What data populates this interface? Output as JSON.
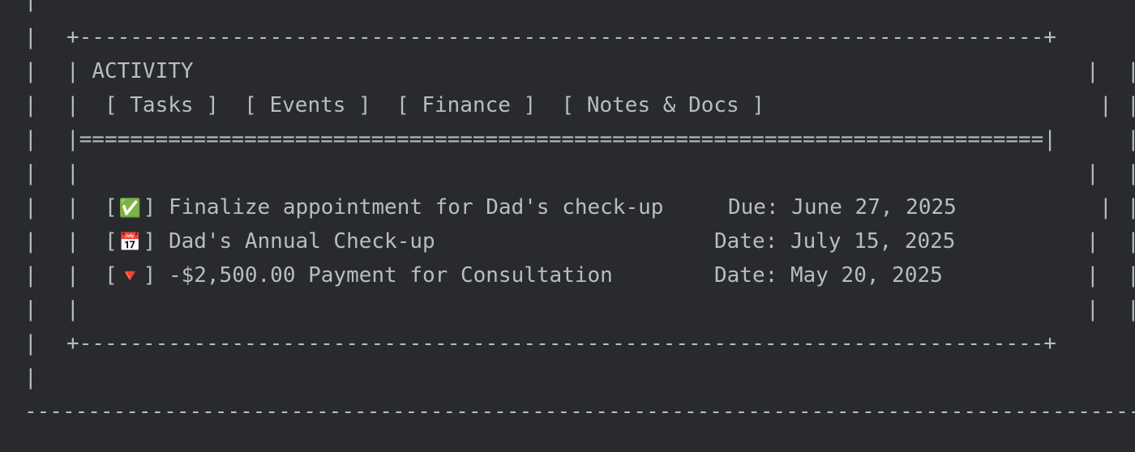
{
  "panel": {
    "title": "ACTIVITY",
    "tabs": [
      {
        "label": "[ Tasks ]"
      },
      {
        "label": "[ Events ]"
      },
      {
        "label": "[ Finance ]"
      },
      {
        "label": "[ Notes & Docs ]"
      }
    ]
  },
  "items": [
    {
      "icon": "✅",
      "icon_name": "check-mark-icon",
      "text": "Finalize appointment for Dad's check-up",
      "date_label": "Due:",
      "date": "June 27, 2025"
    },
    {
      "icon": "📅",
      "icon_name": "calendar-icon",
      "text": "Dad's Annual Check-up",
      "date_label": "Date:",
      "date": "July 15, 2025"
    },
    {
      "icon": "🔻",
      "icon_name": "red-down-triangle-icon",
      "text": "-$2,500.00 Payment for Consultation",
      "date_label": "Date:",
      "date": "May 20, 2025"
    }
  ]
}
